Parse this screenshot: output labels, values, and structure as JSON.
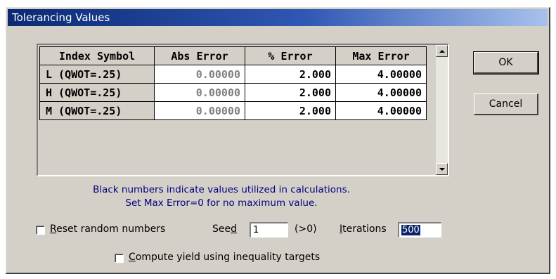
{
  "window": {
    "title": "Tolerancing Values"
  },
  "table": {
    "columns": [
      "Index Symbol",
      "Abs Error",
      "% Error",
      "Max Error"
    ],
    "rows": [
      {
        "symbol": "L (QWOT=.25)",
        "abs_error": "0.00000",
        "pct_error": "2.000",
        "max_error": "4.00000"
      },
      {
        "symbol": "H (QWOT=.25)",
        "abs_error": "0.00000",
        "pct_error": "2.000",
        "max_error": "4.00000"
      },
      {
        "symbol": "M (QWOT=.25)",
        "abs_error": "0.00000",
        "pct_error": "2.000",
        "max_error": "4.00000"
      }
    ]
  },
  "buttons": {
    "ok": "OK",
    "cancel": "Cancel"
  },
  "info": {
    "line1": "Black numbers indicate values utilized in calculations.",
    "line2": "Set Max Error=0 for no maximum value."
  },
  "options": {
    "reset_random_label_mnemonic": "R",
    "reset_random_label_rest": "eset random numbers",
    "reset_random_checked": false,
    "seed_label_pre": "See",
    "seed_label_mnemonic": "d",
    "seed_value": "1",
    "seed_hint": "(>0)",
    "iterations_label_mnemonic": "I",
    "iterations_label_rest": "terations",
    "iterations_value": "500",
    "yield_label_mnemonic": "C",
    "yield_label_rest": "ompute yield using inequality targets",
    "yield_checked": false
  },
  "colors": {
    "title_gradient_start": "#0b2a73",
    "title_gradient_end": "#a8c2ec",
    "dialog_bg": "#d4d0c8",
    "info_text": "#000080",
    "disabled_value": "#808080",
    "selection": "#0a246a"
  }
}
